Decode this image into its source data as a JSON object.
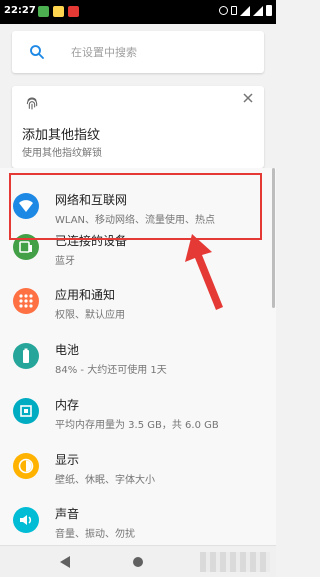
{
  "status_bar": {
    "time": "22:27",
    "icons": [
      "wechat-icon",
      "photo-icon",
      "app-icon",
      "alarm-icon",
      "vibrate-icon",
      "signal-icon",
      "battery-icon"
    ]
  },
  "search": {
    "placeholder": "在设置中搜索"
  },
  "suggestion": {
    "title": "添加其他指纹",
    "subtitle": "使用其他指纹解锁"
  },
  "settings": [
    {
      "title": "网络和互联网",
      "subtitle": "WLAN、移动网络、流量使用、热点",
      "icon": "wifi-icon",
      "color": "#2196f3"
    },
    {
      "title": "已连接的设备",
      "subtitle": "蓝牙",
      "icon": "devices-icon",
      "color": "#4caf50"
    },
    {
      "title": "应用和通知",
      "subtitle": "权限、默认应用",
      "icon": "apps-icon",
      "color": "#ff7043"
    },
    {
      "title": "电池",
      "subtitle": "84% - 大约还可使用 1天",
      "icon": "battery-icon",
      "color": "#26a69a"
    },
    {
      "title": "内存",
      "subtitle": "平均内存用量为 3.5 GB，共 6.0 GB",
      "icon": "memory-icon",
      "color": "#00acc1"
    },
    {
      "title": "显示",
      "subtitle": "壁纸、休眠、字体大小",
      "icon": "display-icon",
      "color": "#ffb300"
    },
    {
      "title": "声音",
      "subtitle": "音量、振动、勿扰",
      "icon": "sound-icon",
      "color": "#00bcd4"
    }
  ],
  "colors": {
    "accent": "#2196f3",
    "highlight": "#e53935"
  },
  "navbar": [
    "back-icon",
    "home-icon"
  ]
}
